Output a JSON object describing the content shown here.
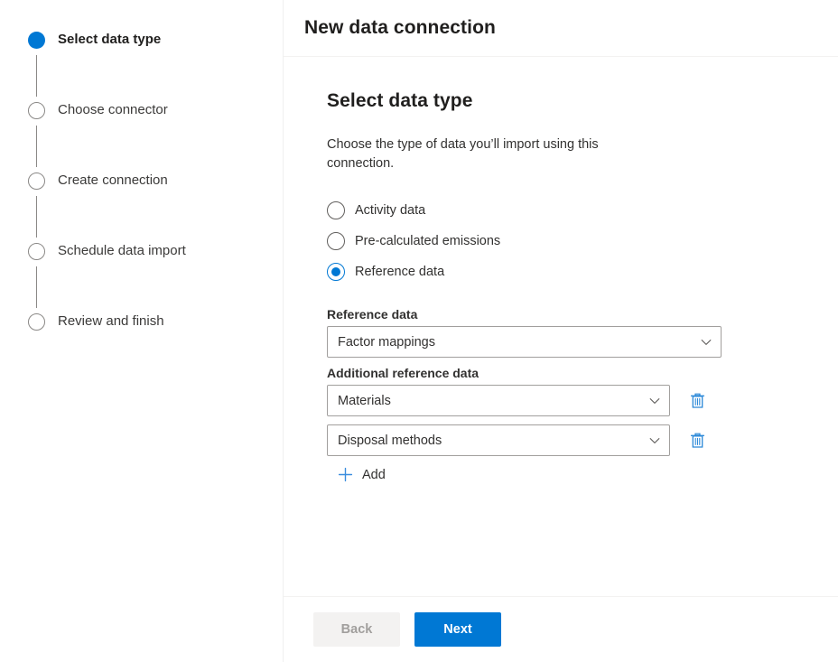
{
  "window": {
    "title": "New data connection"
  },
  "colors": {
    "accent": "#0078d4",
    "step_inactive": "#8a8886",
    "border": "#a19f9d",
    "disabled_bg": "#f3f2f1",
    "disabled_text": "#a19f9d"
  },
  "wizard": {
    "steps": [
      {
        "label": "Select data type",
        "state": "active"
      },
      {
        "label": "Choose connector",
        "state": "pending"
      },
      {
        "label": "Create connection",
        "state": "pending"
      },
      {
        "label": "Schedule data import",
        "state": "pending"
      },
      {
        "label": "Review and finish",
        "state": "pending"
      }
    ]
  },
  "main": {
    "heading": "Select data type",
    "description": "Choose the type of data you’ll import using this connection.",
    "radios": [
      {
        "label": "Activity data",
        "checked": false
      },
      {
        "label": "Pre-calculated emissions",
        "checked": false
      },
      {
        "label": "Reference data",
        "checked": true
      }
    ],
    "reference_data": {
      "label": "Reference data",
      "value": "Factor mappings"
    },
    "additional_reference_data": {
      "label": "Additional reference data",
      "rows": [
        {
          "value": "Materials",
          "delete_icon": "trash-icon"
        },
        {
          "value": "Disposal methods",
          "delete_icon": "trash-icon"
        }
      ],
      "add_label": "Add",
      "add_icon": "plus-icon"
    }
  },
  "footer": {
    "back_label": "Back",
    "next_label": "Next"
  }
}
